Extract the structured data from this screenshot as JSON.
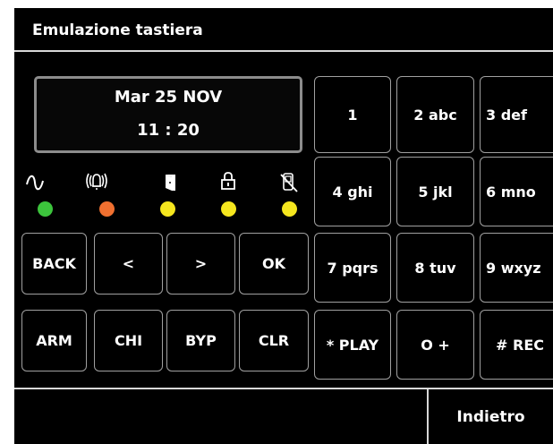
{
  "header": {
    "title": "Emulazione tastiera"
  },
  "display": {
    "line1": "Mar 25  NOV",
    "line2": "11 : 20"
  },
  "indicators": [
    {
      "icon": "power-wave-icon",
      "color": "#3cc43c"
    },
    {
      "icon": "alarm-bell-icon",
      "color": "#f07030"
    },
    {
      "icon": "door-icon",
      "color": "#f5e61e"
    },
    {
      "icon": "padlock-icon",
      "color": "#f5e61e"
    },
    {
      "icon": "phone-off-icon",
      "color": "#f5e61e"
    }
  ],
  "keypad": {
    "r1": [
      "1",
      "2 abc",
      "3 def"
    ],
    "r2": [
      "4 ghi",
      "5 jkl",
      "6 mno"
    ],
    "r3": [
      "7 pqrs",
      "8 tuv",
      "9 wxyz"
    ],
    "r4": [
      "* PLAY",
      "O  +",
      "# REC"
    ]
  },
  "controls": {
    "back": "BACK",
    "left": "<",
    "right": ">",
    "ok": "OK",
    "arm": "ARM",
    "chi": "CHI",
    "byp": "BYP",
    "clr": "CLR"
  },
  "footer": {
    "back_label": "Indietro"
  }
}
